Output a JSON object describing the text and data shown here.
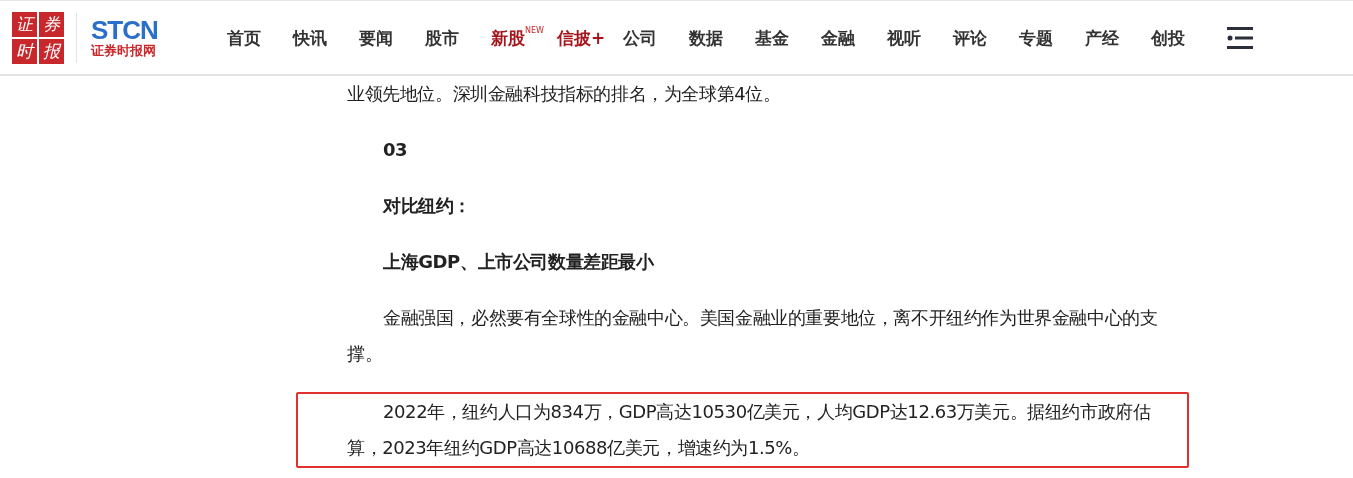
{
  "logo": {
    "seal": [
      "证",
      "券",
      "时",
      "报"
    ],
    "brand": "STCN",
    "site_name": "证券时报网"
  },
  "nav": [
    {
      "label": "首页",
      "kind": "normal"
    },
    {
      "label": "快讯",
      "kind": "normal"
    },
    {
      "label": "要闻",
      "kind": "normal"
    },
    {
      "label": "股市",
      "kind": "normal"
    },
    {
      "label": "新股",
      "kind": "featured",
      "badge": "NEW"
    },
    {
      "label": "信披+",
      "kind": "featured"
    },
    {
      "label": "公司",
      "kind": "normal"
    },
    {
      "label": "数据",
      "kind": "normal"
    },
    {
      "label": "基金",
      "kind": "normal"
    },
    {
      "label": "金融",
      "kind": "normal"
    },
    {
      "label": "视听",
      "kind": "normal"
    },
    {
      "label": "评论",
      "kind": "normal"
    },
    {
      "label": "专题",
      "kind": "normal"
    },
    {
      "label": "产经",
      "kind": "normal"
    },
    {
      "label": "创投",
      "kind": "normal"
    }
  ],
  "article": [
    {
      "kind": "continuation",
      "text": "业领先地位。深圳金融科技指标的排名，为全球第4位。",
      "highlighted": false
    },
    {
      "kind": "heading",
      "text": "03",
      "highlighted": false
    },
    {
      "kind": "heading",
      "text": "对比纽约：",
      "highlighted": false
    },
    {
      "kind": "heading",
      "text": "上海GDP、上市公司数量差距最小",
      "highlighted": false
    },
    {
      "kind": "text",
      "text": "金融强国，必然要有全球性的金融中心。美国金融业的重要地位，离不开纽约作为世界金融中心的支撑。",
      "highlighted": false
    },
    {
      "kind": "text",
      "text": "2022年，纽约人口为834万，GDP高达10530亿美元，人均GDP达12.63万美元。据纽约市政府估算，2023年纽约GDP高达10688亿美元，增速约为1.5%。",
      "highlighted": true
    }
  ]
}
